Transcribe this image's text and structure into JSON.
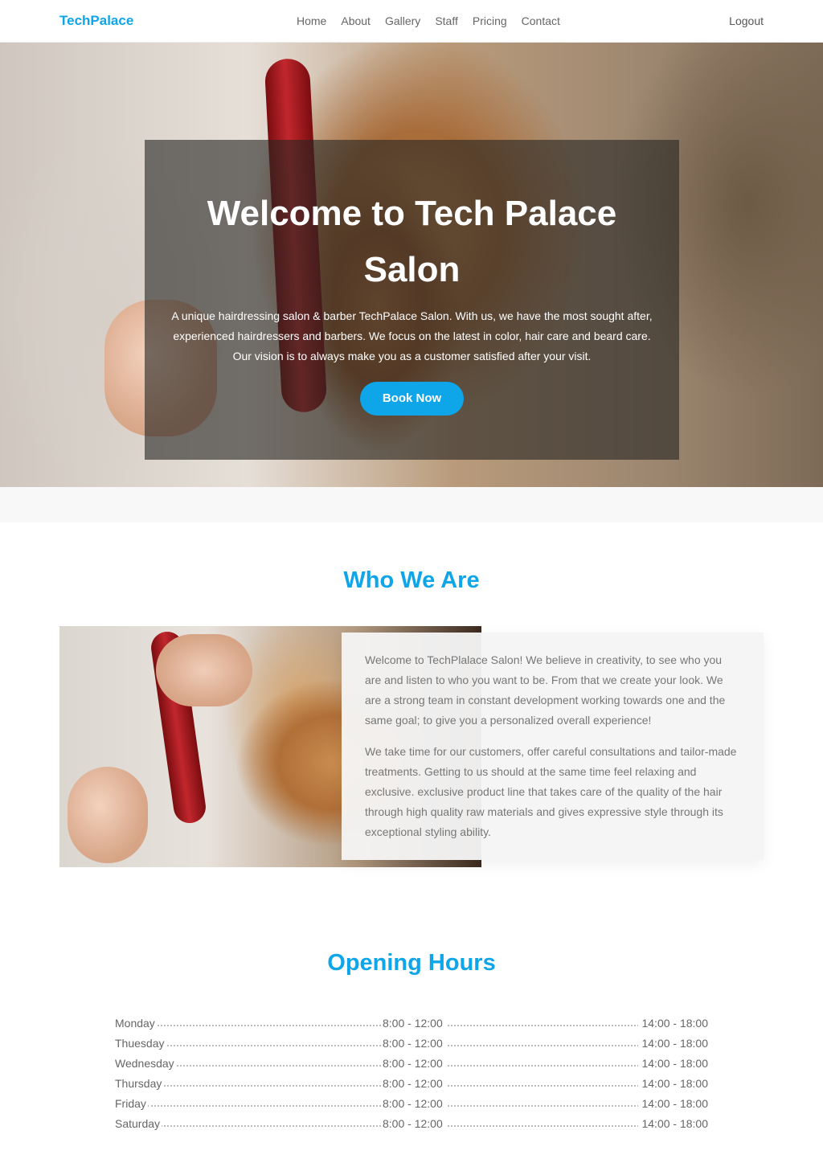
{
  "nav": {
    "brand": "TechPalace",
    "items": [
      "Home",
      "About",
      "Gallery",
      "Staff",
      "Pricing",
      "Contact"
    ],
    "logout": "Logout"
  },
  "hero": {
    "title_line1": "Welcome to Tech Palace",
    "title_line2": "Salon",
    "text": "A unique hairdressing salon & barber TechPalace Salon. With us, we have the most sought after, experienced hairdressers and barbers. We focus on the latest in color, hair care and beard care. Our vision is to always make you as a customer satisfied after your visit.",
    "cta": "Book Now"
  },
  "about": {
    "title": "Who We Are",
    "para1": "Welcome to TechPlalace Salon! We believe in creativity, to see who you are and listen to who you want to be. From that we create your look. We are a strong team in constant development working towards one and the same goal; to give you a personalized overall experience!",
    "para2": "We take time for our customers, offer careful consultations and tailor-made treatments. Getting to us should at the same time feel relaxing and exclusive. exclusive product line that takes care of the quality of the hair through high quality raw materials and gives expressive style through its exceptional styling ability."
  },
  "hours": {
    "title": "Opening Hours",
    "rows": [
      {
        "day": "Monday",
        "am": "8:00 - 12:00",
        "pm": "14:00 - 18:00"
      },
      {
        "day": "Thuesday",
        "am": "8:00 - 12:00",
        "pm": "14:00 - 18:00"
      },
      {
        "day": "Wednesday",
        "am": "8:00 - 12:00",
        "pm": "14:00 - 18:00"
      },
      {
        "day": "Thursday",
        "am": "8:00 - 12:00",
        "pm": "14:00 - 18:00"
      },
      {
        "day": "Friday",
        "am": "8:00 - 12:00",
        "pm": "14:00 - 18:00"
      },
      {
        "day": "Saturday",
        "am": "8:00 - 12:00",
        "pm": "14:00 - 18:00"
      }
    ]
  },
  "colors": {
    "accent": "#0ea5e9",
    "text": "#555555"
  }
}
